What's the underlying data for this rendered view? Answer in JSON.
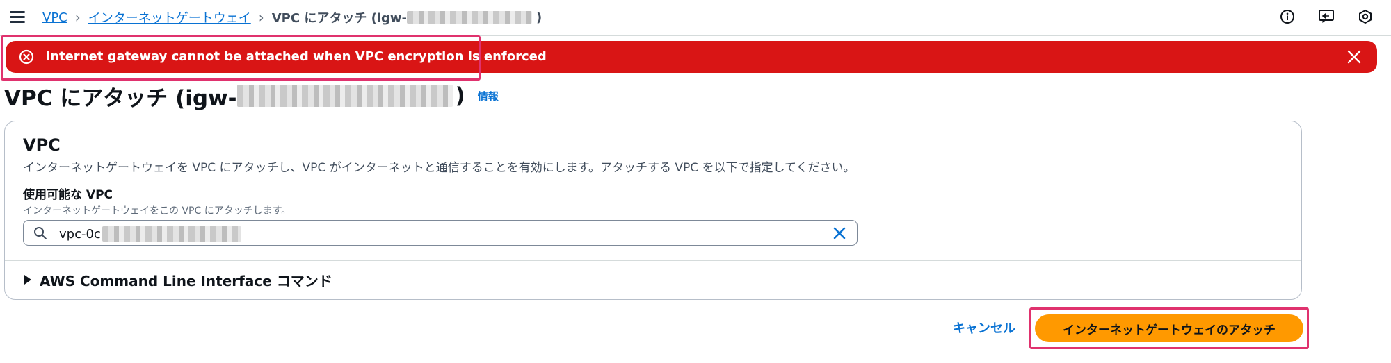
{
  "breadcrumb": {
    "items": [
      "VPC",
      "インターネットゲートウェイ"
    ],
    "current_prefix": "VPC にアタッチ (igw-",
    "current_suffix": ")"
  },
  "top_icons": [
    "info-icon",
    "feedback-icon",
    "settings-icon"
  ],
  "flash": {
    "type": "error",
    "message": "internet gateway cannot be attached when VPC encryption is enforced",
    "color": "#d91515"
  },
  "heading": {
    "title_prefix": "VPC にアタッチ (igw-",
    "title_suffix": ")",
    "info_link": "情報"
  },
  "container": {
    "title": "VPC",
    "description": "インターネットゲートウェイを VPC にアタッチし、VPC がインターネットと通信することを有効にします。アタッチする VPC を以下で指定してください。",
    "field_label": "使用可能な VPC",
    "field_description": "インターネットゲートウェイをこの VPC にアタッチします。",
    "input_value": "vpc-0c",
    "cli_expander": "AWS Command Line Interface コマンド"
  },
  "actions": {
    "cancel_label": "キャンセル",
    "attach_label": "インターネットゲートウェイのアタッチ"
  },
  "colors": {
    "link": "#0972d3",
    "primary_button": "#ff9900",
    "annotation_highlight": "#e0326e"
  }
}
